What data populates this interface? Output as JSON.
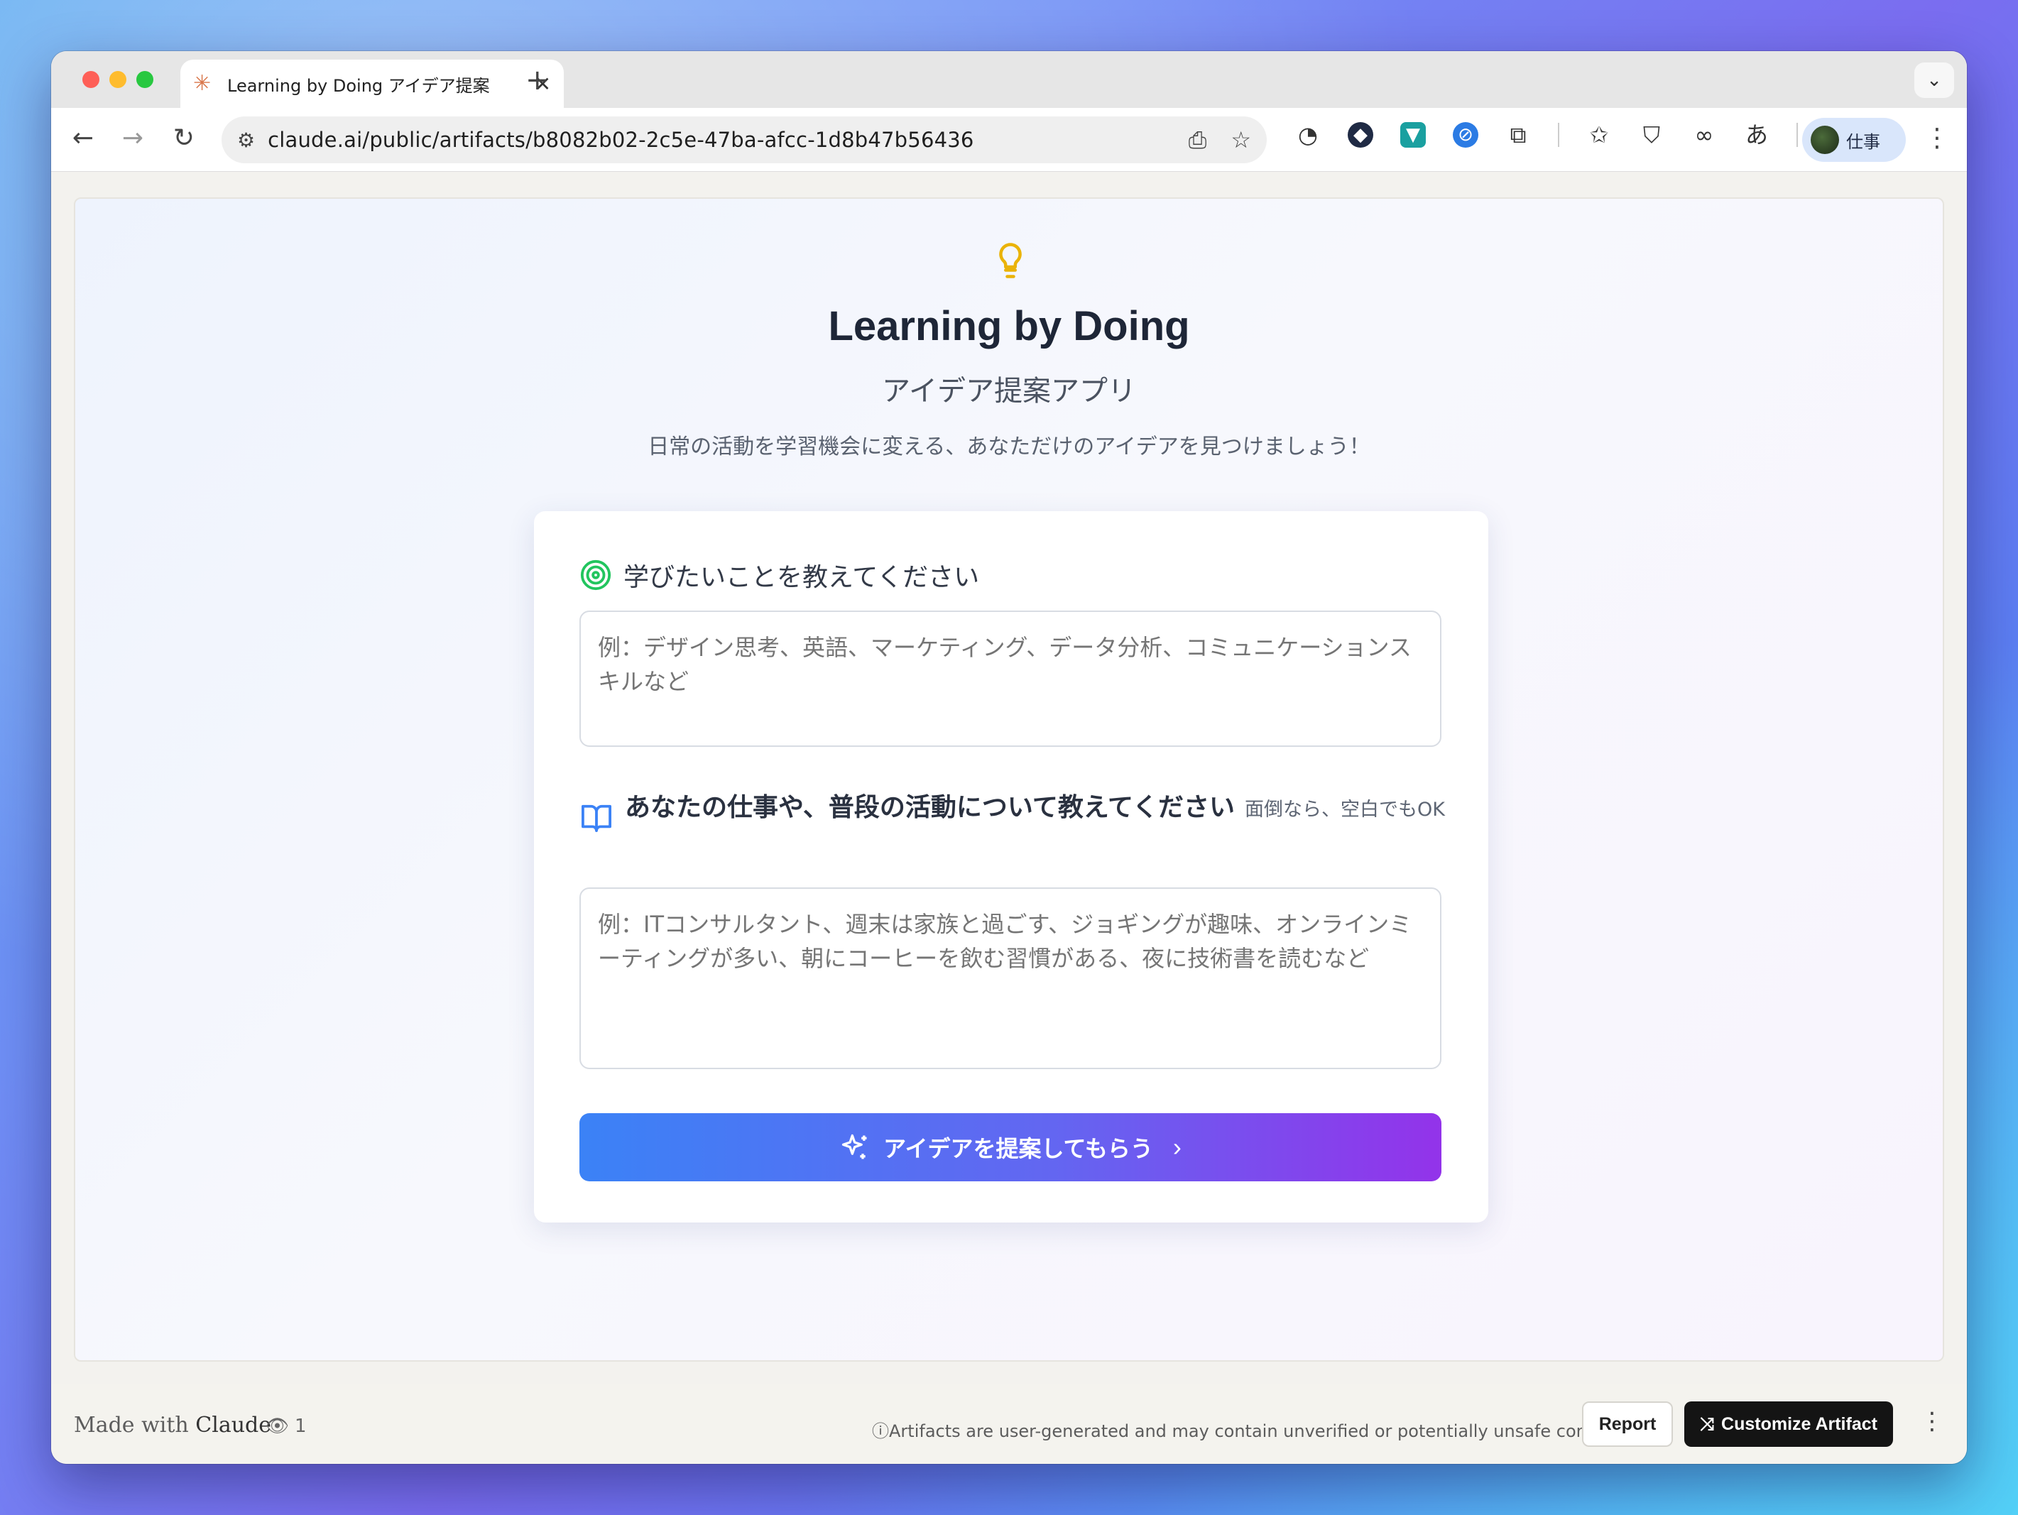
{
  "browser": {
    "tab_title": "Learning by Doing アイデア提案",
    "url": "claude.ai/public/artifacts/b8082b02-2c5e-47ba-afcc-1d8b47b56436",
    "profile_name": "仕事",
    "icons": [
      "back-icon",
      "forward-icon",
      "reload-icon",
      "site-info-icon",
      "install-icon",
      "bookmark-star-icon",
      "password-icon",
      "extension-cube-icon",
      "extension-map-icon",
      "extension-link-icon",
      "extensions-puzzle-icon",
      "reading-list-icon",
      "incognito-icon",
      "link-icon",
      "translate-icon",
      "more-menu-icon"
    ]
  },
  "app": {
    "title": "Learning by Doing",
    "subtitle": "アイデア提案アプリ",
    "tagline": "日常の活動を学習機会に変える、あなただけのアイデアを見つけましょう！",
    "q1_label": "学びたいことを教えてください",
    "q1_placeholder": "例：デザイン思考、英語、マーケティング、データ分析、コミュニケーションスキルなど",
    "q2_label": "あなたの仕事や、普段の活動について教えてください",
    "q2_note": "面倒なら、空白でもOK",
    "q2_placeholder": "例：ITコンサルタント、週末は家族と過ごす、ジョギングが趣味、オンラインミーティングが多い、朝にコーヒーを飲む習慣がある、夜に技術書を読むなど",
    "submit_label": "アイデアを提案してもらう"
  },
  "footer": {
    "made_with_prefix": "Made with",
    "made_with_brand": "Claude",
    "views": "1",
    "disclaimer": "Artifacts are user-generated and may contain unverified or potentially unsafe content.",
    "report_label": "Report",
    "customize_label": "Customize Artifact"
  },
  "colors": {
    "accent_start": "#3b82f6",
    "accent_end": "#9333ea",
    "target_icon": "#22c55e",
    "book_icon": "#3b82f6",
    "bulb_icon": "#eab308"
  }
}
